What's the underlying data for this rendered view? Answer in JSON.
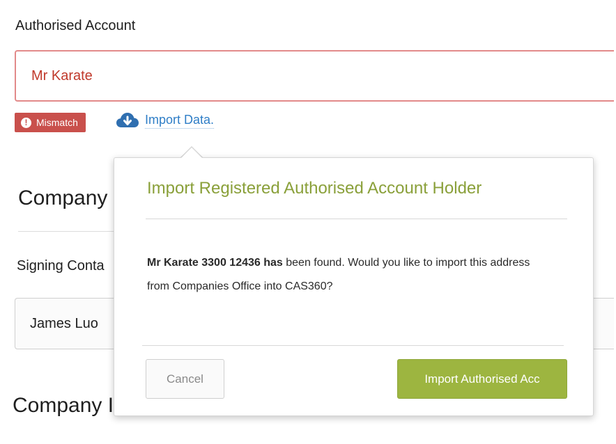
{
  "form": {
    "authorised_account_label": "Authorised Account",
    "authorised_account_value": "Mr Karate",
    "mismatch_badge": "Mismatch",
    "mismatch_icon": "exclamation-circle-icon",
    "import_link": "Import Data.",
    "import_icon": "cloud-download-icon",
    "company_section_title": "Company",
    "signing_contact_label": "Signing Conta",
    "signing_contact_value": "James Luo",
    "company_section_title_2": "Company I"
  },
  "popover": {
    "title": "Import Registered Authorised Account Holder",
    "body_strong": "Mr Karate 3300 12436  has",
    "body_rest": " been found. Would you like to import this address from Companies Office into CAS360?",
    "cancel_label": "Cancel",
    "import_label": "Import Authorised Acc"
  },
  "colors": {
    "error": "#c9504c",
    "link": "#2f7ec7",
    "accent_green": "#9db540",
    "title_green": "#8aa03a"
  }
}
